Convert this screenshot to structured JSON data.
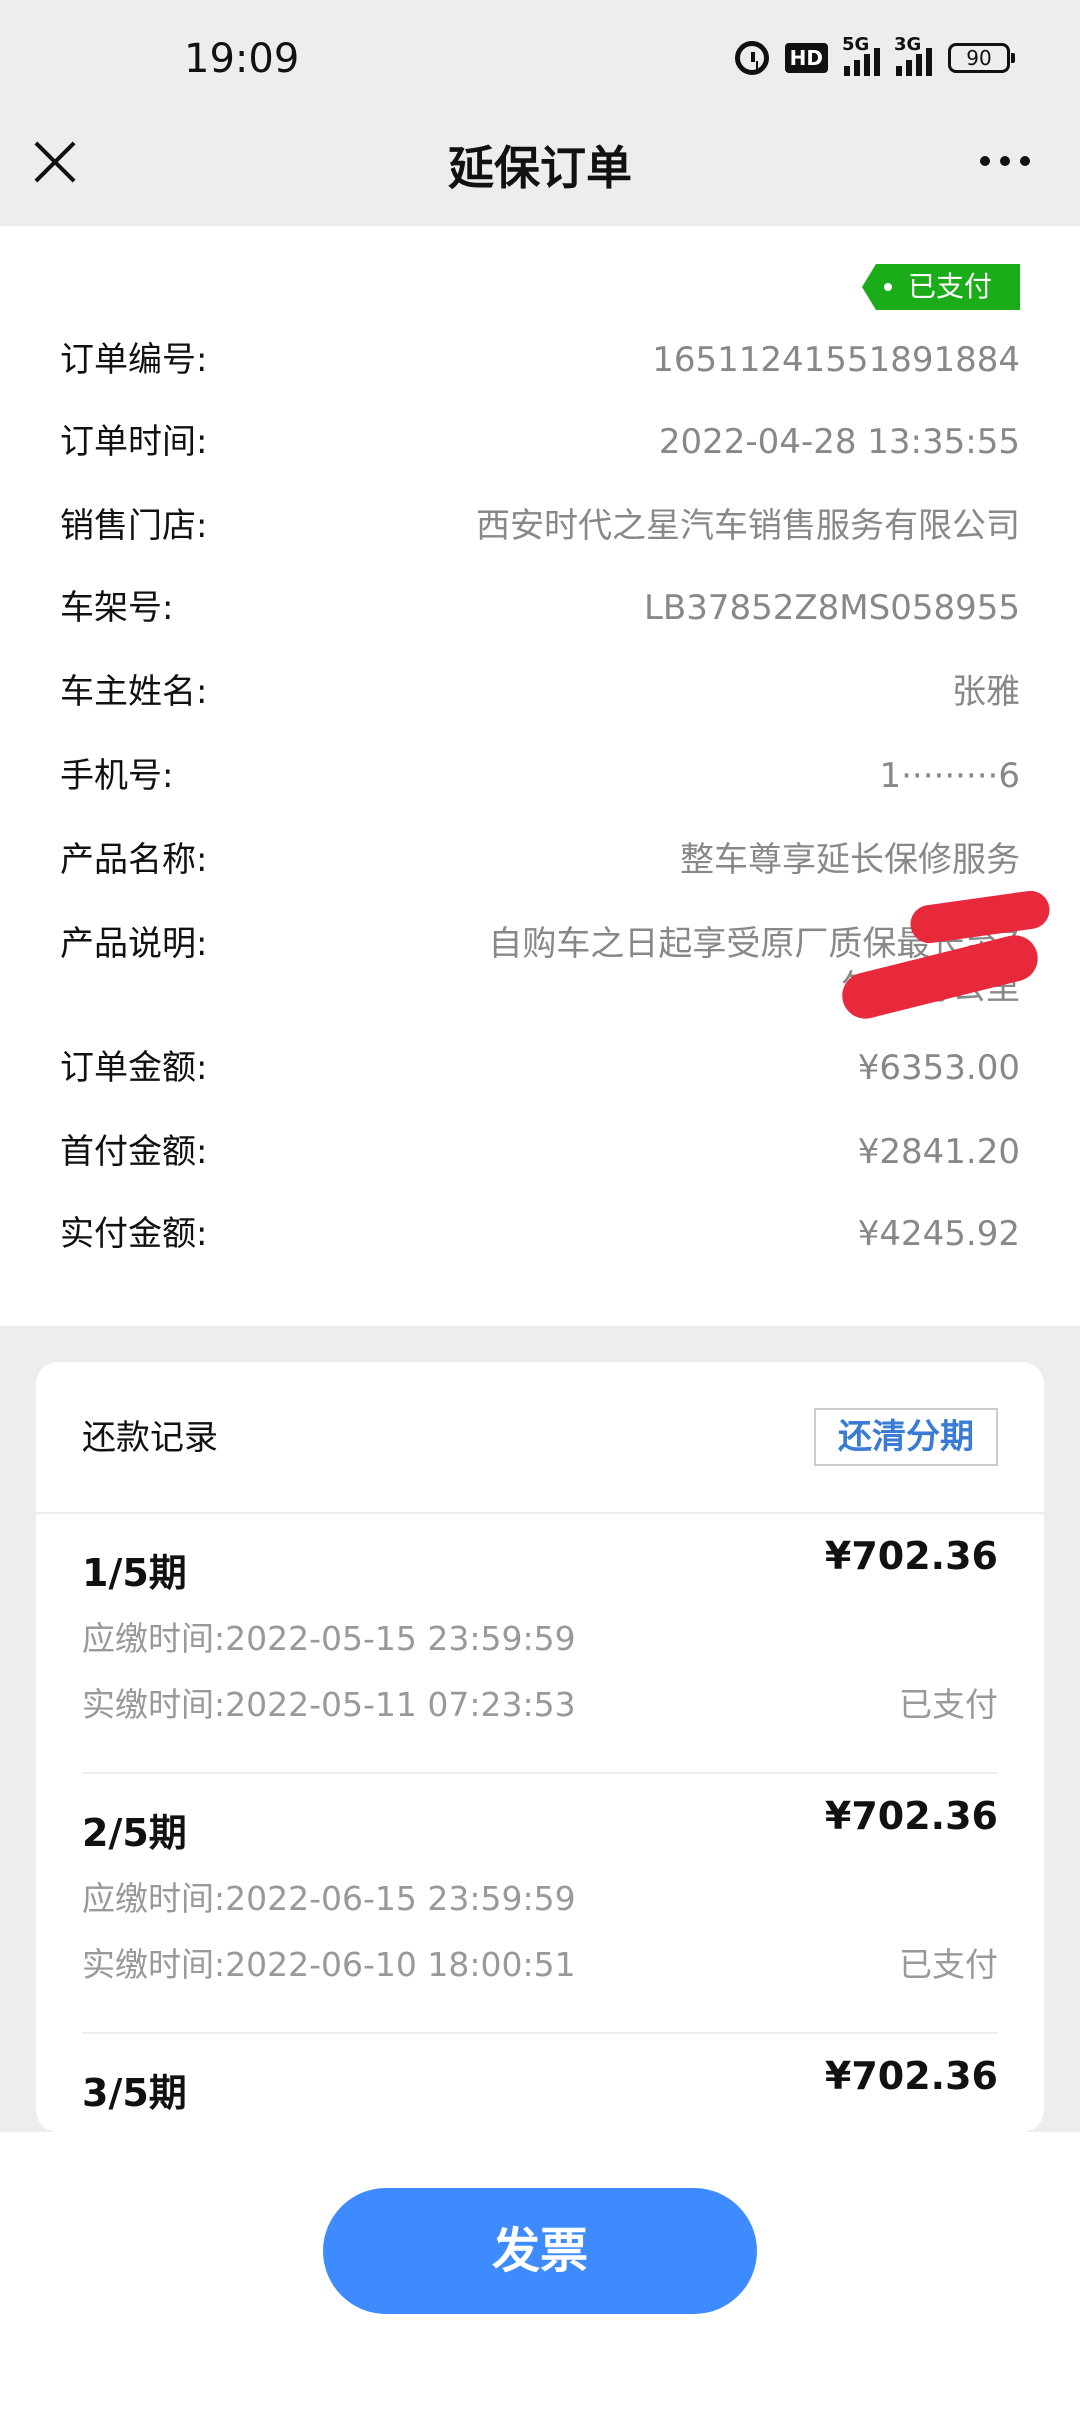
{
  "status_bar": {
    "time": "19:09",
    "hd": "HD",
    "net1": "5G",
    "net2": "3G",
    "battery": "90"
  },
  "nav": {
    "title": "延保订单"
  },
  "order": {
    "status_tag": "已支付",
    "rows": [
      {
        "label": "订单编号:",
        "value": "16511241551891884"
      },
      {
        "label": "订单时间:",
        "value": "2022-04-28 13:35:55"
      },
      {
        "label": "销售门店:",
        "value": "西安时代之星汽车销售服务有限公司"
      },
      {
        "label": "车架号:",
        "value": "LB37852Z8MS058955"
      },
      {
        "label": "车主姓名:",
        "value": "张雅"
      },
      {
        "label": "手机号:",
        "value": "1·········6"
      },
      {
        "label": "产品名称:",
        "value": "整车尊享延长保修服务"
      },
      {
        "label": "产品说明:",
        "value": "自购车之日起享受原厂质保最长至7年20万公里"
      },
      {
        "label": "订单金额:",
        "value": "¥6353.00"
      },
      {
        "label": "首付金额:",
        "value": "¥2841.20"
      },
      {
        "label": "实付金额:",
        "value": "¥4245.92"
      }
    ]
  },
  "repayment": {
    "title": "还款记录",
    "clear_button": "还清分期",
    "periods": [
      {
        "name": "1/5期",
        "amount": "¥702.36",
        "due_label": "应缴时间:",
        "due": "2022-05-15 23:59:59",
        "paid_label": "实缴时间:",
        "paid": "2022-05-11 07:23:53",
        "status": "已支付"
      },
      {
        "name": "2/5期",
        "amount": "¥702.36",
        "due_label": "应缴时间:",
        "due": "2022-06-15 23:59:59",
        "paid_label": "实缴时间:",
        "paid": "2022-06-10 18:00:51",
        "status": "已支付"
      },
      {
        "name": "3/5期",
        "amount": "¥702.36"
      }
    ]
  },
  "footer": {
    "invoice_button": "发票"
  }
}
